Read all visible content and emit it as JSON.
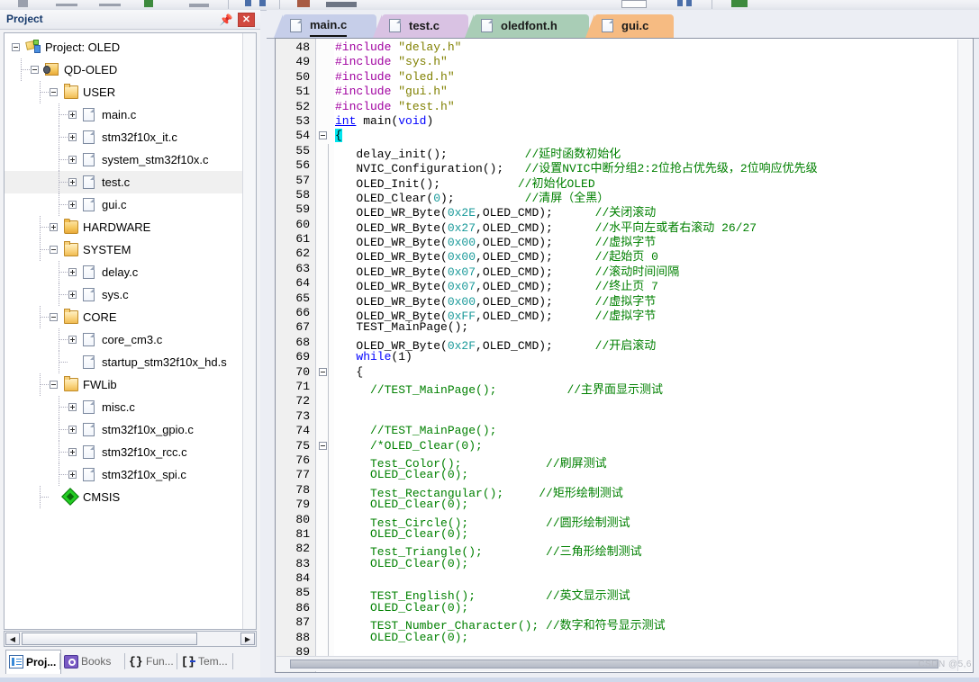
{
  "window": {
    "project_panel_title": "Project",
    "pin_icon": "pin-icon",
    "close_icon": "✕"
  },
  "toolbar": {
    "items": [
      "save-icon",
      "cut-icon",
      "copy-icon",
      "paste-icon",
      "undo-icon",
      "redo-icon",
      "navigate-back-icon",
      "navigate-forward-icon",
      "bookmark-icon",
      "build-icon",
      "rebuild-icon",
      "target-select",
      "options-icon",
      "debug-icon"
    ]
  },
  "tree": {
    "nodes": [
      {
        "label": "Project: OLED",
        "depth": 0,
        "icon": "project-icon",
        "expander": "minus",
        "selected": false
      },
      {
        "label": "QD-OLED",
        "depth": 1,
        "icon": "target-icon",
        "expander": "minus",
        "selected": false
      },
      {
        "label": "USER",
        "depth": 2,
        "icon": "folder-open-icon",
        "expander": "minus",
        "selected": false
      },
      {
        "label": "main.c",
        "depth": 3,
        "icon": "file-icon",
        "expander": "plus",
        "selected": false
      },
      {
        "label": "stm32f10x_it.c",
        "depth": 3,
        "icon": "file-icon",
        "expander": "plus",
        "selected": false
      },
      {
        "label": "system_stm32f10x.c",
        "depth": 3,
        "icon": "file-icon",
        "expander": "plus",
        "selected": false
      },
      {
        "label": "test.c",
        "depth": 3,
        "icon": "file-icon",
        "expander": "plus",
        "selected": true
      },
      {
        "label": "gui.c",
        "depth": 3,
        "icon": "file-icon",
        "expander": "plus",
        "selected": false
      },
      {
        "label": "HARDWARE",
        "depth": 2,
        "icon": "folder-icon",
        "expander": "plus",
        "selected": false
      },
      {
        "label": "SYSTEM",
        "depth": 2,
        "icon": "folder-open-icon",
        "expander": "minus",
        "selected": false
      },
      {
        "label": "delay.c",
        "depth": 3,
        "icon": "file-icon",
        "expander": "plus",
        "selected": false
      },
      {
        "label": "sys.c",
        "depth": 3,
        "icon": "file-icon",
        "expander": "plus",
        "selected": false
      },
      {
        "label": "CORE",
        "depth": 2,
        "icon": "folder-open-icon",
        "expander": "minus",
        "selected": false
      },
      {
        "label": "core_cm3.c",
        "depth": 3,
        "icon": "file-icon",
        "expander": "plus",
        "selected": false
      },
      {
        "label": "startup_stm32f10x_hd.s",
        "depth": 3,
        "icon": "file-icon",
        "expander": "none",
        "selected": false
      },
      {
        "label": "FWLib",
        "depth": 2,
        "icon": "folder-open-icon",
        "expander": "minus",
        "selected": false
      },
      {
        "label": "misc.c",
        "depth": 3,
        "icon": "file-icon",
        "expander": "plus",
        "selected": false
      },
      {
        "label": "stm32f10x_gpio.c",
        "depth": 3,
        "icon": "file-icon",
        "expander": "plus",
        "selected": false
      },
      {
        "label": "stm32f10x_rcc.c",
        "depth": 3,
        "icon": "file-icon",
        "expander": "plus",
        "selected": false
      },
      {
        "label": "stm32f10x_spi.c",
        "depth": 3,
        "icon": "file-icon",
        "expander": "plus",
        "selected": false
      },
      {
        "label": "CMSIS",
        "depth": 2,
        "icon": "cmsis-icon",
        "expander": "none",
        "selected": false
      }
    ],
    "hscroll": {
      "left_arrow": "◀",
      "right_arrow": "▶"
    }
  },
  "panel_tabs": [
    {
      "label": "Proj...",
      "icon": "project-window-icon",
      "active": true
    },
    {
      "label": "Books",
      "icon": "books-icon",
      "active": false
    },
    {
      "label": "Fun...",
      "icon": "functions-icon",
      "active": false
    },
    {
      "label": "Tem...",
      "icon": "templates-icon",
      "active": false
    }
  ],
  "editor_tabs": [
    {
      "label": "main.c",
      "color": "#c6cee9",
      "active": true
    },
    {
      "label": "test.c",
      "color": "#d9c2e3",
      "active": false
    },
    {
      "label": "oledfont.h",
      "color": "#a9cdb6",
      "active": false
    },
    {
      "label": "gui.c",
      "color": "#f6bb82",
      "active": false
    }
  ],
  "colors": {
    "preprocessor": "#a000a0",
    "string": "#808000",
    "keyword": "#0000ff",
    "number": "#1a9a9a",
    "comment": "#008000",
    "cursor_highlight": "#00e5ee"
  },
  "code": {
    "first_line_number": 48,
    "lines": [
      {
        "n": 48,
        "fold": "none",
        "tokens": [
          {
            "t": "#include ",
            "c": "s-pre"
          },
          {
            "t": "\"delay.h\"",
            "c": "s-str"
          }
        ]
      },
      {
        "n": 49,
        "fold": "none",
        "tokens": [
          {
            "t": "#include ",
            "c": "s-pre"
          },
          {
            "t": "\"sys.h\"",
            "c": "s-str"
          }
        ]
      },
      {
        "n": 50,
        "fold": "none",
        "tokens": [
          {
            "t": "#include ",
            "c": "s-pre"
          },
          {
            "t": "\"oled.h\"",
            "c": "s-str"
          }
        ]
      },
      {
        "n": 51,
        "fold": "none",
        "tokens": [
          {
            "t": "#include ",
            "c": "s-pre"
          },
          {
            "t": "\"gui.h\"",
            "c": "s-str"
          }
        ]
      },
      {
        "n": 52,
        "fold": "none",
        "tokens": [
          {
            "t": "#include ",
            "c": "s-pre"
          },
          {
            "t": "\"test.h\"",
            "c": "s-str"
          }
        ]
      },
      {
        "n": 53,
        "fold": "none",
        "tokens": [
          {
            "t": "int",
            "c": "s-kw"
          },
          {
            "t": " main(",
            "c": ""
          },
          {
            "t": "void",
            "c": "s-kw2"
          },
          {
            "t": ")",
            "c": ""
          }
        ]
      },
      {
        "n": 54,
        "fold": "minus",
        "tokens": [
          {
            "t": "{",
            "c": "s-cur"
          }
        ]
      },
      {
        "n": 55,
        "fold": "none",
        "bar": true,
        "tokens": [
          {
            "t": "   delay_init();           ",
            "c": ""
          },
          {
            "t": "//延时函数初始化",
            "c": "s-cmt"
          }
        ]
      },
      {
        "n": 56,
        "fold": "none",
        "bar": true,
        "tokens": [
          {
            "t": "   NVIC_Configuration();   ",
            "c": ""
          },
          {
            "t": "//设置NVIC中断分组2:2位抢占优先级，2位响应优先级",
            "c": "s-cmt"
          }
        ]
      },
      {
        "n": 57,
        "fold": "none",
        "bar": true,
        "tokens": [
          {
            "t": "   OLED_Init();           ",
            "c": ""
          },
          {
            "t": "//初始化OLED",
            "c": "s-cmt"
          }
        ]
      },
      {
        "n": 58,
        "fold": "none",
        "bar": true,
        "tokens": [
          {
            "t": "   OLED_Clear(",
            "c": ""
          },
          {
            "t": "0",
            "c": "s-num"
          },
          {
            "t": ");          ",
            "c": ""
          },
          {
            "t": "//清屏（全黑）",
            "c": "s-cmt"
          }
        ]
      },
      {
        "n": 59,
        "fold": "none",
        "bar": true,
        "tokens": [
          {
            "t": "   OLED_WR_Byte(",
            "c": ""
          },
          {
            "t": "0x2E",
            "c": "s-num"
          },
          {
            "t": ",OLED_CMD);      ",
            "c": ""
          },
          {
            "t": "//关闭滚动",
            "c": "s-cmt"
          }
        ]
      },
      {
        "n": 60,
        "fold": "none",
        "bar": true,
        "tokens": [
          {
            "t": "   OLED_WR_Byte(",
            "c": ""
          },
          {
            "t": "0x27",
            "c": "s-num"
          },
          {
            "t": ",OLED_CMD);      ",
            "c": ""
          },
          {
            "t": "//水平向左或者右滚动 26/27",
            "c": "s-cmt"
          }
        ]
      },
      {
        "n": 61,
        "fold": "none",
        "bar": true,
        "tokens": [
          {
            "t": "   OLED_WR_Byte(",
            "c": ""
          },
          {
            "t": "0x00",
            "c": "s-num"
          },
          {
            "t": ",OLED_CMD);      ",
            "c": ""
          },
          {
            "t": "//虚拟字节",
            "c": "s-cmt"
          }
        ]
      },
      {
        "n": 62,
        "fold": "none",
        "bar": true,
        "tokens": [
          {
            "t": "   OLED_WR_Byte(",
            "c": ""
          },
          {
            "t": "0x00",
            "c": "s-num"
          },
          {
            "t": ",OLED_CMD);      ",
            "c": ""
          },
          {
            "t": "//起始页 0",
            "c": "s-cmt"
          }
        ]
      },
      {
        "n": 63,
        "fold": "none",
        "bar": true,
        "tokens": [
          {
            "t": "   OLED_WR_Byte(",
            "c": ""
          },
          {
            "t": "0x07",
            "c": "s-num"
          },
          {
            "t": ",OLED_CMD);      ",
            "c": ""
          },
          {
            "t": "//滚动时间间隔",
            "c": "s-cmt"
          }
        ]
      },
      {
        "n": 64,
        "fold": "none",
        "bar": true,
        "tokens": [
          {
            "t": "   OLED_WR_Byte(",
            "c": ""
          },
          {
            "t": "0x07",
            "c": "s-num"
          },
          {
            "t": ",OLED_CMD);      ",
            "c": ""
          },
          {
            "t": "//终止页 7",
            "c": "s-cmt"
          }
        ]
      },
      {
        "n": 65,
        "fold": "none",
        "bar": true,
        "tokens": [
          {
            "t": "   OLED_WR_Byte(",
            "c": ""
          },
          {
            "t": "0x00",
            "c": "s-num"
          },
          {
            "t": ",OLED_CMD);      ",
            "c": ""
          },
          {
            "t": "//虚拟字节",
            "c": "s-cmt"
          }
        ]
      },
      {
        "n": 66,
        "fold": "none",
        "bar": true,
        "tokens": [
          {
            "t": "   OLED_WR_Byte(",
            "c": ""
          },
          {
            "t": "0xFF",
            "c": "s-num"
          },
          {
            "t": ",OLED_CMD);      ",
            "c": ""
          },
          {
            "t": "//虚拟字节",
            "c": "s-cmt"
          }
        ]
      },
      {
        "n": 67,
        "fold": "none",
        "bar": true,
        "tokens": [
          {
            "t": "   TEST_MainPage();",
            "c": ""
          }
        ]
      },
      {
        "n": 68,
        "fold": "none",
        "bar": true,
        "tokens": [
          {
            "t": "   OLED_WR_Byte(",
            "c": ""
          },
          {
            "t": "0x2F",
            "c": "s-num"
          },
          {
            "t": ",OLED_CMD);      ",
            "c": ""
          },
          {
            "t": "//开启滚动",
            "c": "s-cmt"
          }
        ]
      },
      {
        "n": 69,
        "fold": "none",
        "bar": true,
        "tokens": [
          {
            "t": "   ",
            "c": ""
          },
          {
            "t": "while",
            "c": "s-kw2"
          },
          {
            "t": "(1)",
            "c": ""
          }
        ]
      },
      {
        "n": 70,
        "fold": "minus",
        "bar": true,
        "tokens": [
          {
            "t": "   {",
            "c": ""
          }
        ]
      },
      {
        "n": 71,
        "fold": "none",
        "bar": true,
        "tokens": [
          {
            "t": "     //TEST_MainPage();          //主界面显示测试",
            "c": "s-cmt"
          }
        ]
      },
      {
        "n": 72,
        "fold": "none",
        "bar": true,
        "tokens": [
          {
            "t": "",
            "c": ""
          }
        ]
      },
      {
        "n": 73,
        "fold": "none",
        "bar": true,
        "tokens": [
          {
            "t": "",
            "c": ""
          }
        ]
      },
      {
        "n": 74,
        "fold": "none",
        "bar": true,
        "tokens": [
          {
            "t": "     //TEST_MainPage();",
            "c": "s-cmt"
          }
        ]
      },
      {
        "n": 75,
        "fold": "minus",
        "bar": true,
        "tokens": [
          {
            "t": "     /*OLED_Clear(0);",
            "c": "s-cmt"
          }
        ]
      },
      {
        "n": 76,
        "fold": "none",
        "bar": true,
        "tokens": [
          {
            "t": "     Test_Color();            //刷屏测试",
            "c": "s-cmt"
          }
        ]
      },
      {
        "n": 77,
        "fold": "none",
        "bar": true,
        "tokens": [
          {
            "t": "     OLED_Clear(0);",
            "c": "s-cmt"
          }
        ]
      },
      {
        "n": 78,
        "fold": "none",
        "bar": true,
        "tokens": [
          {
            "t": "     Test_Rectangular();     //矩形绘制测试",
            "c": "s-cmt"
          }
        ]
      },
      {
        "n": 79,
        "fold": "none",
        "bar": true,
        "tokens": [
          {
            "t": "     OLED_Clear(0);",
            "c": "s-cmt"
          }
        ]
      },
      {
        "n": 80,
        "fold": "none",
        "bar": true,
        "tokens": [
          {
            "t": "     Test_Circle();           //圆形绘制测试",
            "c": "s-cmt"
          }
        ]
      },
      {
        "n": 81,
        "fold": "none",
        "bar": true,
        "tokens": [
          {
            "t": "     OLED_Clear(0);",
            "c": "s-cmt"
          }
        ]
      },
      {
        "n": 82,
        "fold": "none",
        "bar": true,
        "tokens": [
          {
            "t": "     Test_Triangle();         //三角形绘制测试",
            "c": "s-cmt"
          }
        ]
      },
      {
        "n": 83,
        "fold": "none",
        "bar": true,
        "tokens": [
          {
            "t": "     OLED_Clear(0);",
            "c": "s-cmt"
          }
        ]
      },
      {
        "n": 84,
        "fold": "none",
        "bar": true,
        "tokens": [
          {
            "t": "",
            "c": ""
          }
        ]
      },
      {
        "n": 85,
        "fold": "none",
        "bar": true,
        "tokens": [
          {
            "t": "     TEST_English();          //英文显示测试",
            "c": "s-cmt"
          }
        ]
      },
      {
        "n": 86,
        "fold": "none",
        "bar": true,
        "tokens": [
          {
            "t": "     OLED_Clear(0);",
            "c": "s-cmt"
          }
        ]
      },
      {
        "n": 87,
        "fold": "none",
        "bar": true,
        "tokens": [
          {
            "t": "     TEST_Number_Character(); //数字和符号显示测试",
            "c": "s-cmt"
          }
        ]
      },
      {
        "n": 88,
        "fold": "none",
        "bar": true,
        "tokens": [
          {
            "t": "     OLED_Clear(0);",
            "c": "s-cmt"
          }
        ]
      },
      {
        "n": 89,
        "fold": "none",
        "bar": true,
        "tokens": [
          {
            "t": "",
            "c": ""
          }
        ]
      }
    ]
  },
  "watermark": "CSDN @5,6"
}
